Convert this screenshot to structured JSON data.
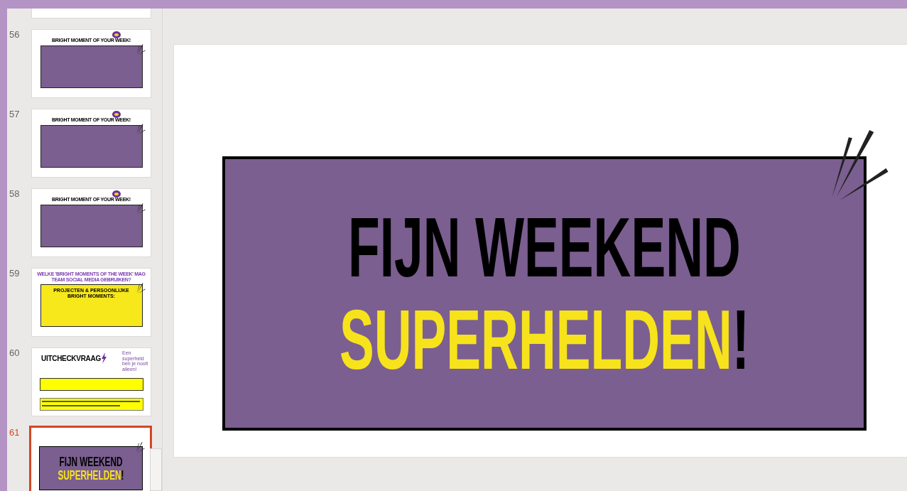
{
  "slides": [
    {
      "kind": "blank",
      "selected": false
    },
    {
      "number": "56",
      "kind": "bright",
      "selected": false,
      "title": "BRIGHT MOMENT OF YOUR WEEK!"
    },
    {
      "number": "57",
      "kind": "bright",
      "selected": false,
      "title": "BRIGHT MOMENT OF YOUR WEEK!"
    },
    {
      "number": "58",
      "kind": "bright",
      "selected": false,
      "title": "BRIGHT MOMENT OF YOUR WEEK!"
    },
    {
      "number": "59",
      "kind": "social",
      "selected": false,
      "title": "WELKE 'BRIGHT MOMENTS OF THE WEEK' MAG TEAM SOCIAL MEDIA GEBRUIKEN?",
      "body": "PROJECTEN & PERSOONLIJKE BRIGHT MOMENTS:"
    },
    {
      "number": "60",
      "kind": "checkout",
      "selected": false,
      "title": "UITCHECKVRAAG",
      "side": "Een superheld ben je nooit alleen!"
    },
    {
      "number": "61",
      "kind": "weekend",
      "selected": true,
      "line1": "FIJN WEEKEND",
      "line2": "SUPERHELDEN",
      "mark": "!"
    }
  ],
  "current": {
    "line1": "FIJN WEEKEND",
    "line2": "SUPERHELDEN",
    "mark": "!"
  }
}
